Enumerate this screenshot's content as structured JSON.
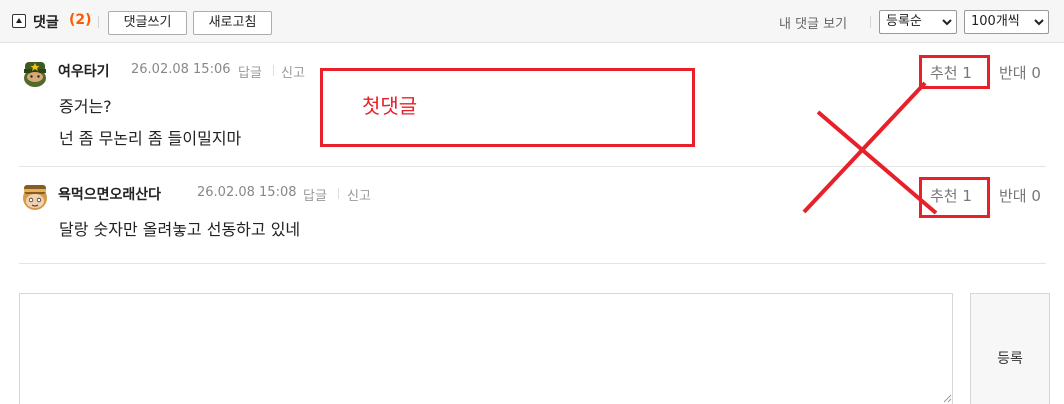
{
  "header": {
    "title": "댓글",
    "count": "(2)",
    "write_button": "댓글쓰기",
    "refresh_button": "새로고침",
    "my_comments_link": "내 댓글 보기",
    "sort_select": "등록순",
    "page_size_select": "100개씩"
  },
  "comments": [
    {
      "nickname": "여우타기",
      "date": "26.02.08 15:06",
      "reply": "답글",
      "report": "신고",
      "lines": [
        "증거는?",
        "넌 좀 무논리 좀 들이밀지마"
      ],
      "recommend_label": "추천",
      "recommend_count": "1",
      "oppose_label": "반대",
      "oppose_count": "0"
    },
    {
      "nickname": "욕먹으면오래산다",
      "date": "26.02.08 15:08",
      "reply": "답글",
      "report": "신고",
      "lines": [
        "달랑 숫자만 올려놓고 선동하고 있네"
      ],
      "recommend_label": "추천",
      "recommend_count": "1",
      "oppose_label": "반대",
      "oppose_count": "0"
    }
  ],
  "editor": {
    "submit_label": "등록"
  },
  "annotation": {
    "label": "첫댓글",
    "color": "#e8202a"
  }
}
